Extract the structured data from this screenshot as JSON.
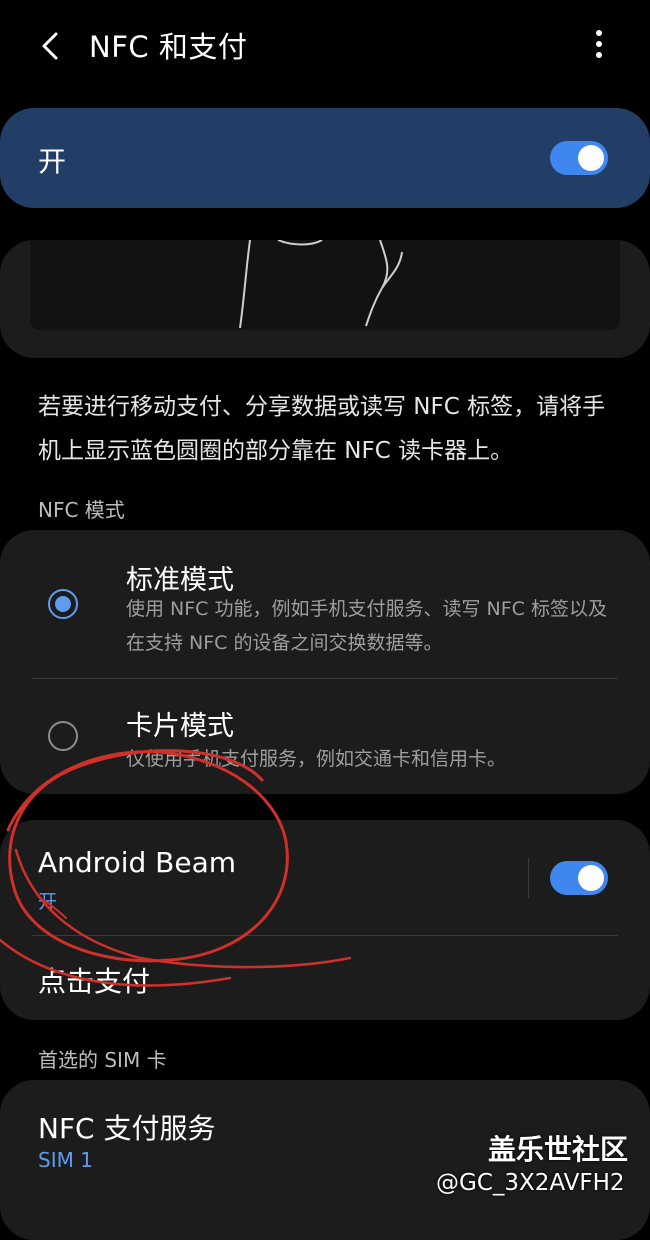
{
  "header": {
    "title": "NFC 和支付",
    "back_icon": "back-arrow-icon",
    "more_icon": "more-vert-icon"
  },
  "master": {
    "label": "开",
    "toggle_on": true
  },
  "description": "若要进行移动支付、分享数据或读写 NFC 标签，请将手机上显示蓝色圆圈的部分靠在 NFC 读卡器上。",
  "nfc_mode": {
    "header": "NFC 模式",
    "options": [
      {
        "title": "标准模式",
        "desc": "使用 NFC 功能，例如手机支付服务、读写 NFC 标签以及在支持 NFC 的设备之间交换数据等。",
        "selected": true
      },
      {
        "title": "卡片模式",
        "desc": "仅使用手机支付服务，例如交通卡和信用卡。",
        "selected": false
      }
    ]
  },
  "beam": {
    "title": "Android Beam",
    "status": "开",
    "toggle_on": true
  },
  "tap_pay": {
    "label": "点击支付"
  },
  "sim": {
    "header": "首选的 SIM 卡",
    "item_title": "NFC 支付服务",
    "item_value": "SIM 1"
  },
  "watermark": {
    "title": "盖乐世社区",
    "user": "@GC_3X2AVFH2"
  },
  "colors": {
    "accent": "#3f86ee",
    "master_card": "#223d66",
    "card": "#1c1c1c",
    "annotation": "#d0302a"
  }
}
